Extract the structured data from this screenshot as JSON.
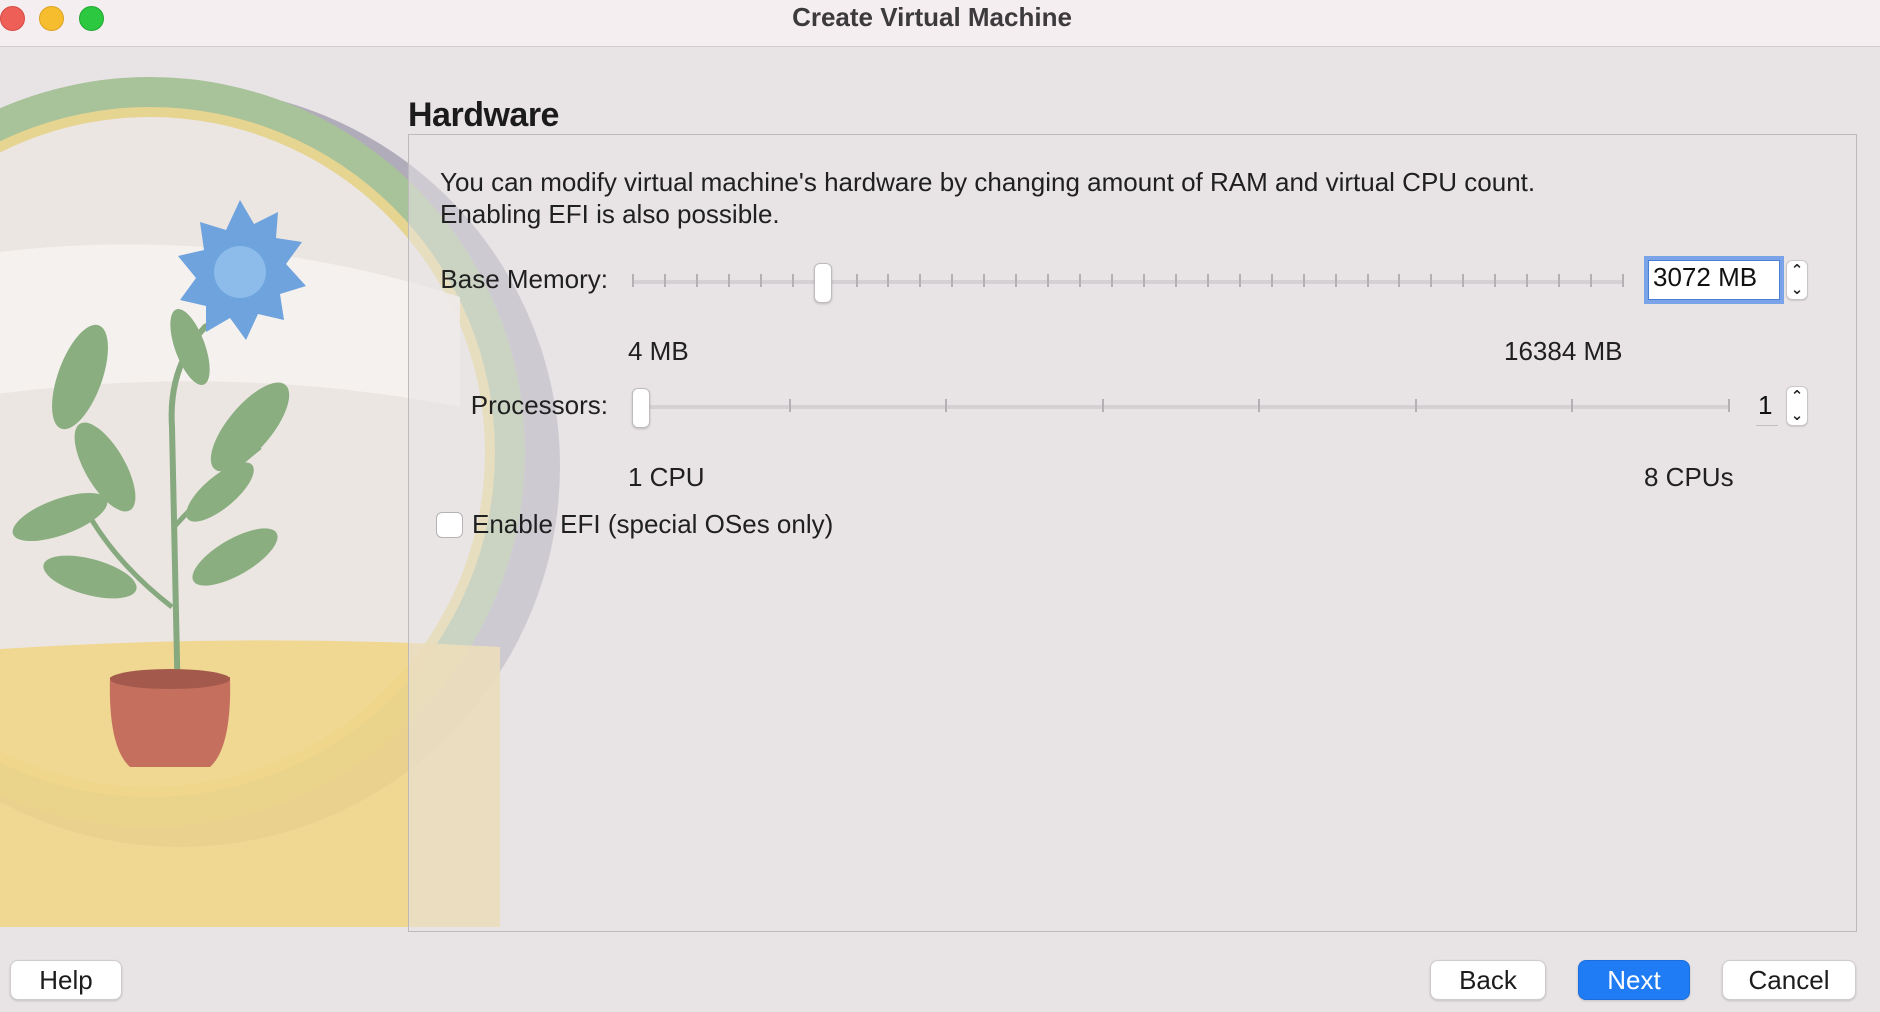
{
  "window": {
    "title": "Create Virtual Machine"
  },
  "page": {
    "heading": "Hardware",
    "description_line1": "You can modify virtual machine's hardware by changing amount of RAM and virtual CPU count.",
    "description_line2": "Enabling EFI is also possible."
  },
  "memory": {
    "label": "Base Memory:",
    "value_text": "3072 MB",
    "value": 3072,
    "unit": "MB",
    "min_label": "4 MB",
    "max_label": "16384 MB",
    "min": 4,
    "max": 16384,
    "tick_count": 32
  },
  "processors": {
    "label": "Processors:",
    "value_text": "1",
    "value": 1,
    "min_label": "1 CPU",
    "max_label": "8 CPUs",
    "min": 1,
    "max": 8
  },
  "efi": {
    "label": "Enable EFI (special OSes only)",
    "checked": false
  },
  "buttons": {
    "help": "Help",
    "back": "Back",
    "next": "Next",
    "cancel": "Cancel"
  },
  "colors": {
    "accent": "#1f7cf5",
    "close": "#ee5f57",
    "minimize": "#f6be2f",
    "maximize": "#2bc840",
    "focus_ring": "#7aa3e8"
  }
}
